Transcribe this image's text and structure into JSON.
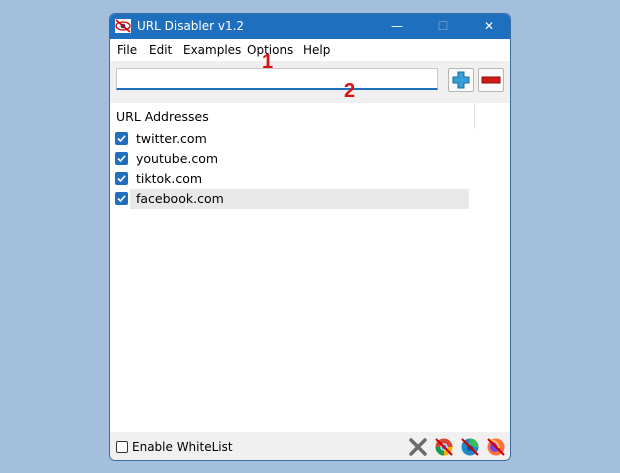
{
  "window": {
    "title": "URL Disabler v1.2",
    "min_glyph": "—",
    "max_glyph": "☐",
    "close_glyph": "✕"
  },
  "menu": [
    "File",
    "Edit",
    "Examples",
    "Options",
    "Help"
  ],
  "url_input": {
    "value": ""
  },
  "markers": {
    "one": "1",
    "two": "2"
  },
  "list": {
    "header": "URL Addresses",
    "items": [
      {
        "label": "twitter.com",
        "checked": true
      },
      {
        "label": "youtube.com",
        "checked": true
      },
      {
        "label": "tiktok.com",
        "checked": true
      },
      {
        "label": "facebook.com",
        "checked": true,
        "selected": true
      }
    ]
  },
  "status": {
    "whitelist_label": "Enable WhiteList",
    "whitelist_checked": false
  },
  "icons": {
    "add": "plus-icon",
    "remove": "minus-icon",
    "status_icons": [
      "close-all-browsers-icon",
      "chrome-icon",
      "edge-icon",
      "firefox-icon"
    ]
  },
  "colors": {
    "accent": "#1f6fbf",
    "add": "#3aa0d8",
    "remove": "#d11a1a",
    "marker": "#e01010",
    "desktop": "#a3bfdb"
  }
}
